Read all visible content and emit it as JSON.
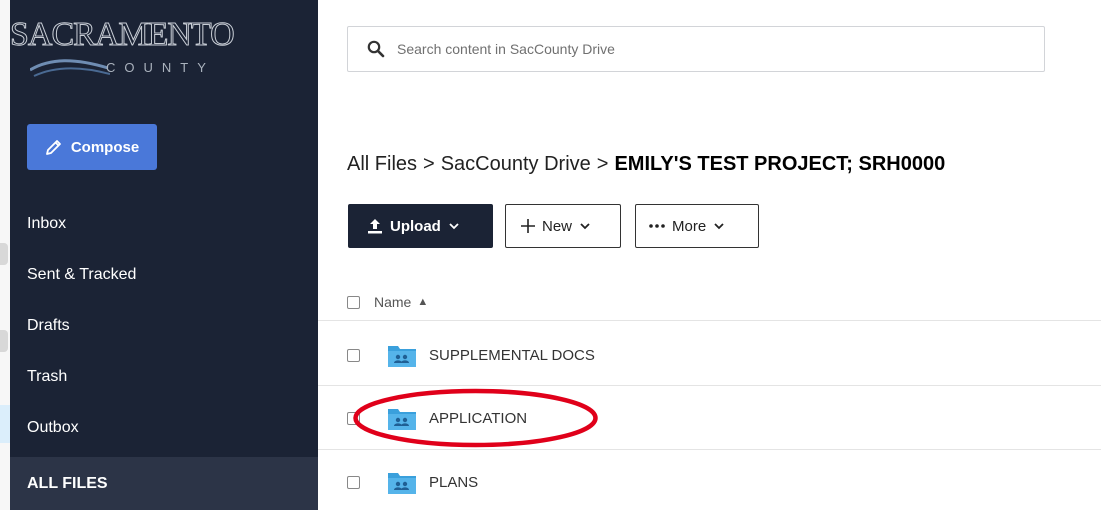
{
  "logo": {
    "title": "SACRAMENTO",
    "subtitle": "COUNTY"
  },
  "sidebar": {
    "compose_label": "Compose",
    "items": [
      {
        "label": "Inbox"
      },
      {
        "label": "Sent & Tracked"
      },
      {
        "label": "Drafts"
      },
      {
        "label": "Trash"
      },
      {
        "label": "Outbox"
      }
    ],
    "active_label": "ALL FILES"
  },
  "search": {
    "placeholder": "Search content in SacCounty Drive"
  },
  "breadcrumb": {
    "items": [
      "All Files",
      "SacCounty Drive"
    ],
    "separator": ">",
    "current": "EMILY'S TEST PROJECT; SRH0000"
  },
  "toolbar": {
    "upload_label": "Upload",
    "new_label": "New",
    "more_label": "More"
  },
  "file_list": {
    "header": {
      "name_label": "Name"
    },
    "rows": [
      {
        "name": "SUPPLEMENTAL DOCS"
      },
      {
        "name": "APPLICATION"
      },
      {
        "name": "PLANS"
      }
    ]
  },
  "colors": {
    "sidebar_bg": "#1b2335",
    "compose_bg": "#4a78d9",
    "folder": "#3aa0dc",
    "annotation": "#e0001a"
  }
}
